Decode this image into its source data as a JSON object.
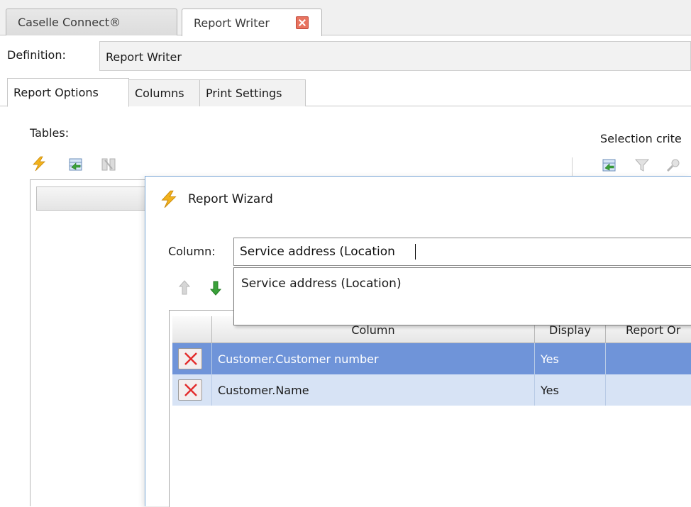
{
  "doc_tabs": [
    {
      "label": "Caselle Connect®"
    },
    {
      "label": "Report Writer"
    }
  ],
  "definition": {
    "label": "Definition:",
    "value": "Report Writer"
  },
  "sub_tabs": [
    {
      "label": "Report Options"
    },
    {
      "label": "Columns"
    },
    {
      "label": "Print Settings"
    }
  ],
  "tables": {
    "label": "Tables:"
  },
  "selection": {
    "label": "Selection crite"
  },
  "wizard": {
    "title": "Report Wizard",
    "column_label": "Column:",
    "column_value": "Service address (Location",
    "suggestions": [
      "Service address (Location)"
    ],
    "grid": {
      "headers": [
        "Column",
        "Display",
        "Report Or"
      ],
      "rows": [
        {
          "column": "Customer.Customer number",
          "display": "Yes",
          "report_order": ""
        },
        {
          "column": "Customer.Name",
          "display": "Yes",
          "report_order": ""
        }
      ]
    }
  },
  "colors": {
    "selected_row": "#6f94d9",
    "alt_row": "#d7e3f5",
    "wizard_icon": "#f2b21c",
    "move_down_arrow": "#3aa13a"
  },
  "icons": {
    "wizard": "lightning-bolt-icon",
    "add_table": "add-table-icon",
    "join": "join-icon",
    "delete": "red-x-icon",
    "move_up": "arrow-up-icon",
    "move_down": "arrow-down-icon"
  }
}
